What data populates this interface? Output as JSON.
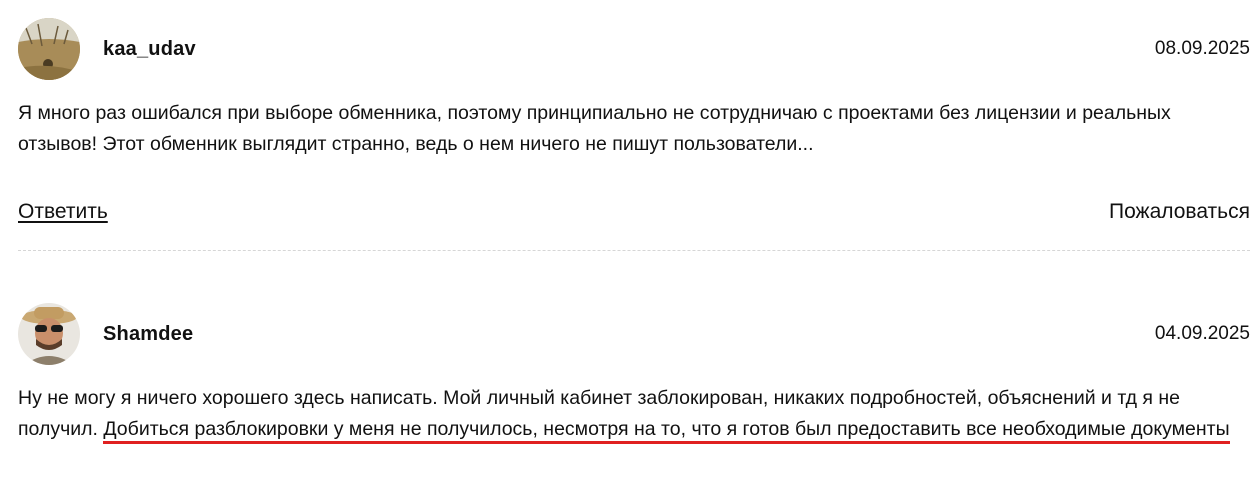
{
  "comments": [
    {
      "username": "kaa_udav",
      "date": "08.09.2025",
      "avatar_icon": "avatar-photo-field",
      "text": "Я много раз ошибался при выборе обменника, поэтому принципиально не сотрудничаю с проектами без лицензии и реальных отзывов! Этот обменник выглядит странно, ведь о нем ничего не пишут пользователи...",
      "reply_label": "Ответить",
      "complain_label": "Пожаловаться"
    },
    {
      "username": "Shamdee",
      "date": "04.09.2025",
      "avatar_icon": "avatar-photo-man-hat",
      "text_plain": "Ну не могу я ничего хорошего здесь написать. Мой личный кабинет заблокирован, никаких подробностей, объяснений и тд я не получил.",
      "text_highlighted": "Добиться разблокировки у меня не получилось, несмотря на то, что я готов был предоставить все необходимые документы",
      "highlight_color": "#e02020"
    }
  ]
}
